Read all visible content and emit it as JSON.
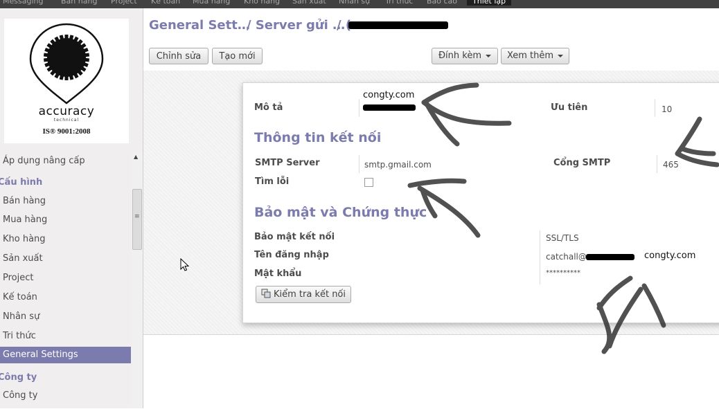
{
  "top_menu": {
    "items": [
      "Messaging",
      "Bán hàng",
      "Project",
      "Kế toán",
      "Mua hàng",
      "Kho hàng",
      "Sản xuất",
      "Nhân sự",
      "Tri thức",
      "Báo cáo"
    ],
    "active": "Thiết lập"
  },
  "logo": {
    "word": "accuracy",
    "sub": "technical",
    "iso": "IS® 9001:2008"
  },
  "sidebar": {
    "items": [
      {
        "label": "Áp dụng nâng cấp",
        "type": "item"
      },
      {
        "label": "Cấu hình",
        "type": "header"
      },
      {
        "label": "Bán hàng",
        "type": "item"
      },
      {
        "label": "Mua hàng",
        "type": "item"
      },
      {
        "label": "Kho hàng",
        "type": "item"
      },
      {
        "label": "Sản xuất",
        "type": "item"
      },
      {
        "label": "Project",
        "type": "item"
      },
      {
        "label": "Kế toán",
        "type": "item"
      },
      {
        "label": "Nhân sự",
        "type": "item"
      },
      {
        "label": "Tri thức",
        "type": "item"
      },
      {
        "label": "General Settings",
        "type": "item",
        "active": true
      },
      {
        "label": "Công ty",
        "type": "header"
      },
      {
        "label": "Công ty",
        "type": "item"
      }
    ]
  },
  "breadcrumb": {
    "part1": "General Sett…",
    "part2": "/ Server gửi …",
    "part3": "/ ("
  },
  "toolbar": {
    "edit_label": "Chỉnh sửa",
    "create_label": "Tạo mới",
    "attach_label": "Đính kèm",
    "view_label": "Xem thêm"
  },
  "form": {
    "description_label": "Mô tả",
    "description_value": "congty.com",
    "priority_label": "Ưu tiên",
    "priority_value": "10",
    "connection_section": "Thông tin kết nối",
    "smtp_server_label": "SMTP Server",
    "smtp_server_value": "smtp.gmail.com",
    "smtp_port_label": "Cổng SMTP",
    "smtp_port_value": "465",
    "debug_label": "Tìm lỗi",
    "debug_checked": false,
    "security_section": "Bảo mật và Chứng thực",
    "conn_security_label": "Bảo mật kết nối",
    "conn_security_value": "SSL/TLS",
    "username_label": "Tên đăng nhập",
    "username_value_prefix": "catchall@",
    "username_value_suffix": "congty.com",
    "password_label": "Mật khẩu",
    "password_value": "**********",
    "test_button_label": "Kiểm tra kết nối"
  }
}
